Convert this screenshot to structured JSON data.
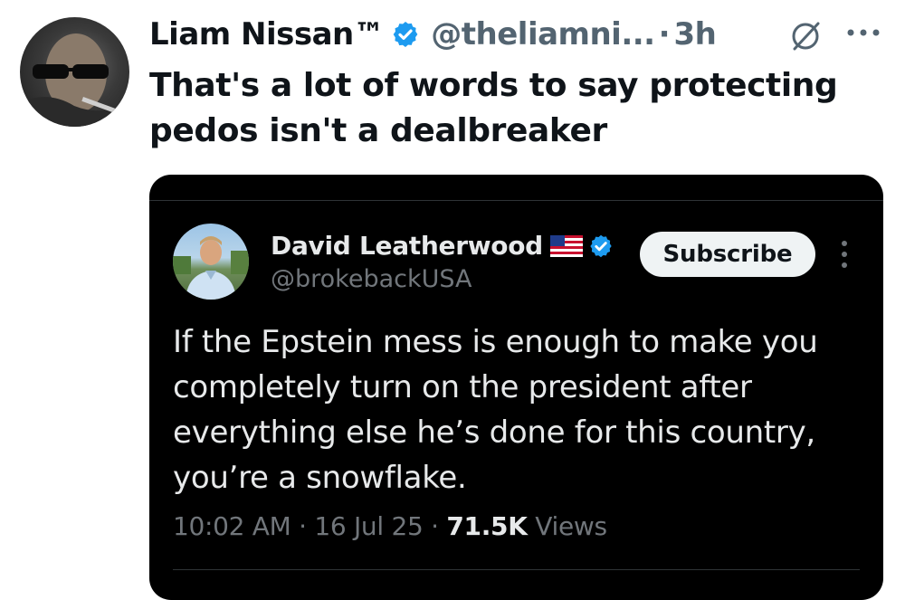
{
  "tweet": {
    "author_name": "Liam Nissan™",
    "author_handle": "@theliamni...",
    "separator": "·",
    "time_ago": "3h",
    "text": "That's a lot of words to say protecting pedos isn't a dealbreaker",
    "icons": {
      "verified": "verified-badge-icon",
      "grok": "grok-icon",
      "more": "more-icon"
    },
    "colors": {
      "verified": "#1d9bf0",
      "secondary_text": "#536471"
    }
  },
  "quoted": {
    "author_name": "David Leatherwood",
    "author_handle": "@brokebackUSA",
    "subscribe_label": "Subscribe",
    "text": "If the Epstein mess is enough to make you completely turn on the president after everything else he’s done for this country, you’re a snowflake.",
    "time": "10:02 AM",
    "sep1": "·",
    "date": "16 Jul 25",
    "sep2": "·",
    "views_count": "71.5K",
    "views_label": "Views",
    "icons": {
      "flag": "us-flag-icon",
      "verified": "verified-badge-icon",
      "more": "more-vertical-icon"
    },
    "colors": {
      "background": "#000000",
      "text": "#e7e9ea",
      "muted": "#71767b"
    }
  }
}
